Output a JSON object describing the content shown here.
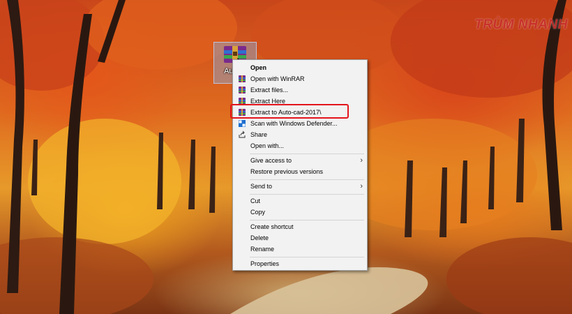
{
  "desktop": {
    "watermark": "TRÙM NHANH",
    "file_icon": {
      "icon": "winrar-archive-icon",
      "label": "Auto-c"
    }
  },
  "context_menu": {
    "items": [
      {
        "label": "Open",
        "bold": true,
        "icon": ""
      },
      {
        "label": "Open with WinRAR",
        "icon": "winrar-icon"
      },
      {
        "label": "Extract files...",
        "icon": "winrar-icon"
      },
      {
        "label": "Extract Here",
        "icon": "winrar-icon"
      },
      {
        "label": "Extract to Auto-cad-2017\\",
        "icon": "winrar-icon",
        "highlighted": true
      },
      {
        "label": "Scan with Windows Defender...",
        "icon": "defender-shield-icon"
      },
      {
        "label": "Share",
        "icon": "share-icon"
      },
      {
        "label": "Open with...",
        "icon": ""
      },
      {
        "label": "Give access to",
        "icon": "",
        "submenu": true
      },
      {
        "label": "Restore previous versions",
        "icon": ""
      },
      {
        "label": "Send to",
        "icon": "",
        "submenu": true
      },
      {
        "label": "Cut",
        "icon": ""
      },
      {
        "label": "Copy",
        "icon": ""
      },
      {
        "label": "Create shortcut",
        "icon": ""
      },
      {
        "label": "Delete",
        "icon": ""
      },
      {
        "label": "Rename",
        "icon": ""
      },
      {
        "label": "Properties",
        "icon": ""
      }
    ]
  },
  "colors": {
    "highlight_border": "#e3141b",
    "menu_bg": "#f2f2f2",
    "watermark": "#c9302c"
  }
}
